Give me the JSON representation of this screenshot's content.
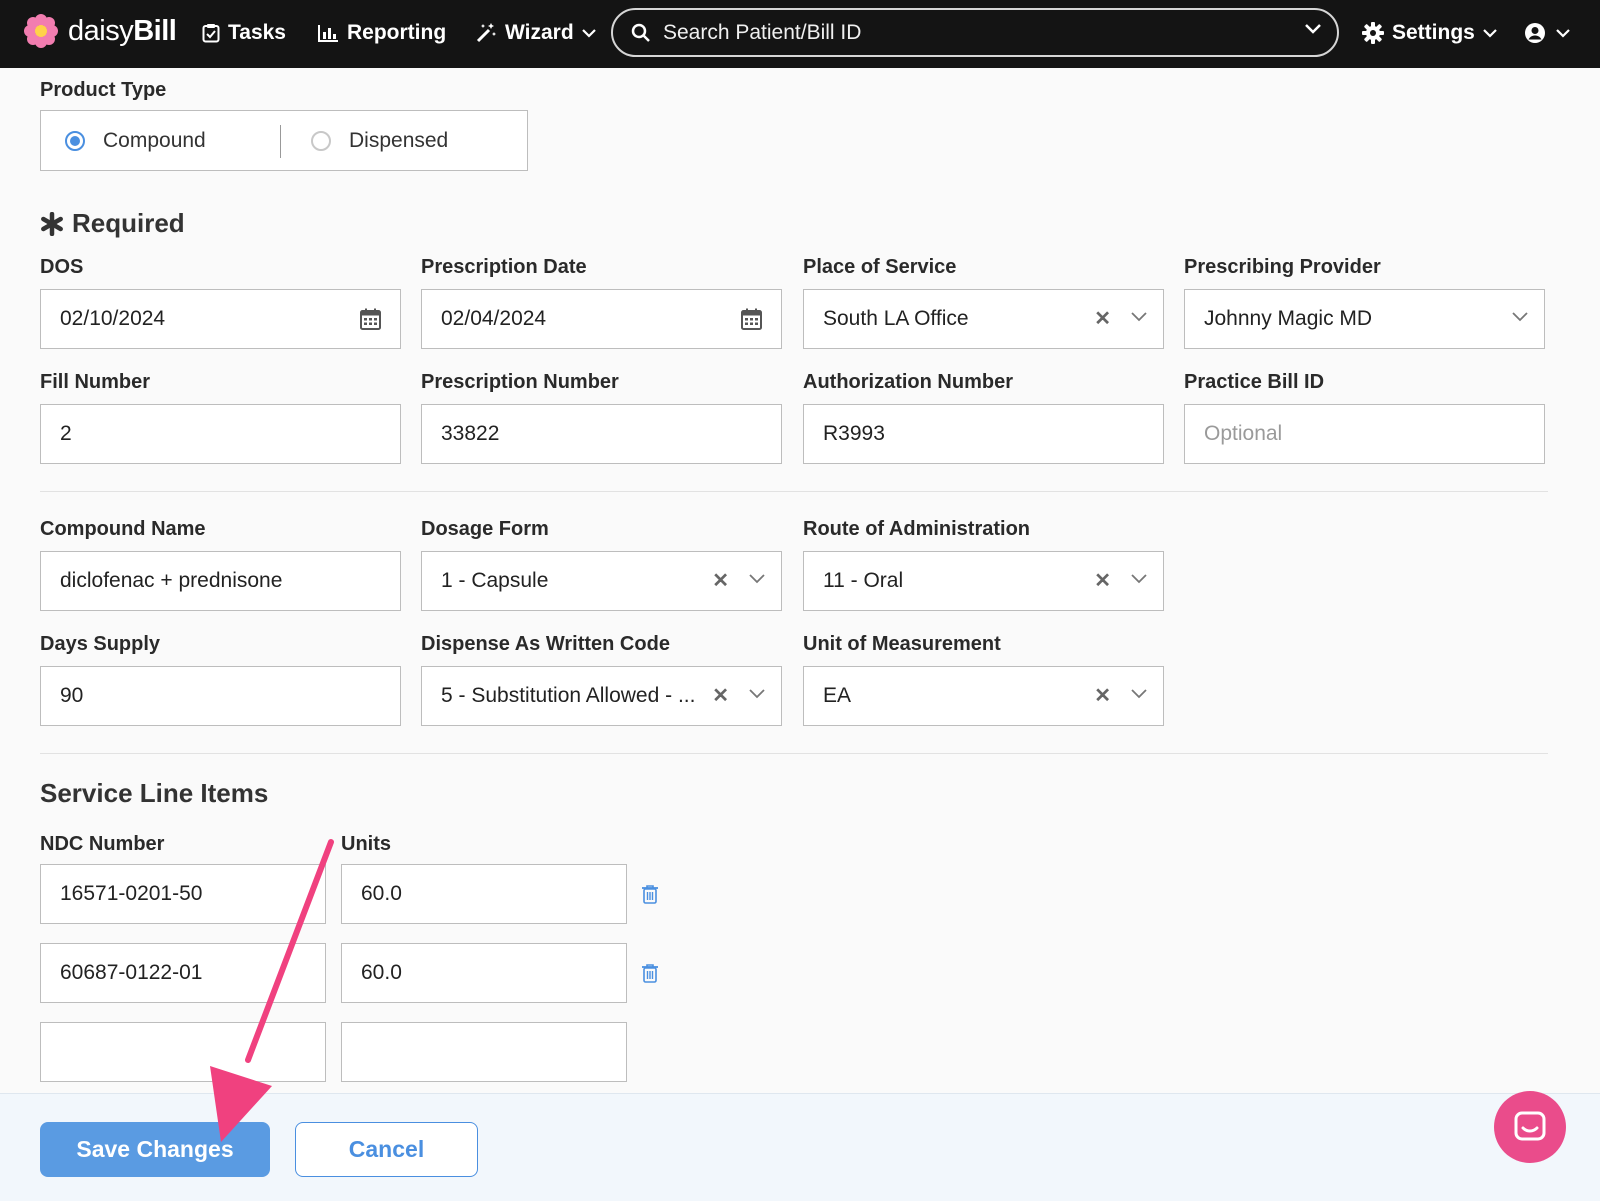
{
  "nav": {
    "brand_prefix": "daisy",
    "brand_suffix": "Bill",
    "tasks": "Tasks",
    "reporting": "Reporting",
    "wizard": "Wizard",
    "search_placeholder": "Search Patient/Bill ID",
    "settings": "Settings"
  },
  "product_type": {
    "label": "Product Type",
    "options": [
      "Compound",
      "Dispensed"
    ],
    "selected": "Compound"
  },
  "required_heading": "Required",
  "fields": {
    "dos": {
      "label": "DOS",
      "value": "02/10/2024"
    },
    "prescription_date": {
      "label": "Prescription Date",
      "value": "02/04/2024"
    },
    "place_of_service": {
      "label": "Place of Service",
      "value": "South LA Office"
    },
    "prescribing_provider": {
      "label": "Prescribing Provider",
      "value": "Johnny Magic MD"
    },
    "fill_number": {
      "label": "Fill Number",
      "value": "2"
    },
    "prescription_number": {
      "label": "Prescription Number",
      "value": "33822"
    },
    "authorization_number": {
      "label": "Authorization Number",
      "value": "R3993"
    },
    "practice_bill_id": {
      "label": "Practice Bill ID",
      "placeholder": "Optional"
    },
    "compound_name": {
      "label": "Compound Name",
      "value": "diclofenac + prednisone"
    },
    "dosage_form": {
      "label": "Dosage Form",
      "value": "1 - Capsule"
    },
    "route": {
      "label": "Route of Administration",
      "value": "11 - Oral"
    },
    "days_supply": {
      "label": "Days Supply",
      "value": "90"
    },
    "daw_code": {
      "label": "Dispense As Written Code",
      "value": "5 - Substitution Allowed - ..."
    },
    "unit_of_measurement": {
      "label": "Unit of Measurement",
      "value": "EA"
    }
  },
  "service_lines": {
    "heading": "Service Line Items",
    "ndc_label": "NDC Number",
    "units_label": "Units",
    "rows": [
      {
        "ndc": "16571-0201-50",
        "units": "60.0"
      },
      {
        "ndc": "60687-0122-01",
        "units": "60.0"
      },
      {
        "ndc": "",
        "units": ""
      }
    ]
  },
  "footer": {
    "save": "Save Changes",
    "cancel": "Cancel"
  },
  "colors": {
    "accent": "#4a8fe0",
    "arrow": "#f0417f",
    "chat": "#ea4c8b"
  }
}
